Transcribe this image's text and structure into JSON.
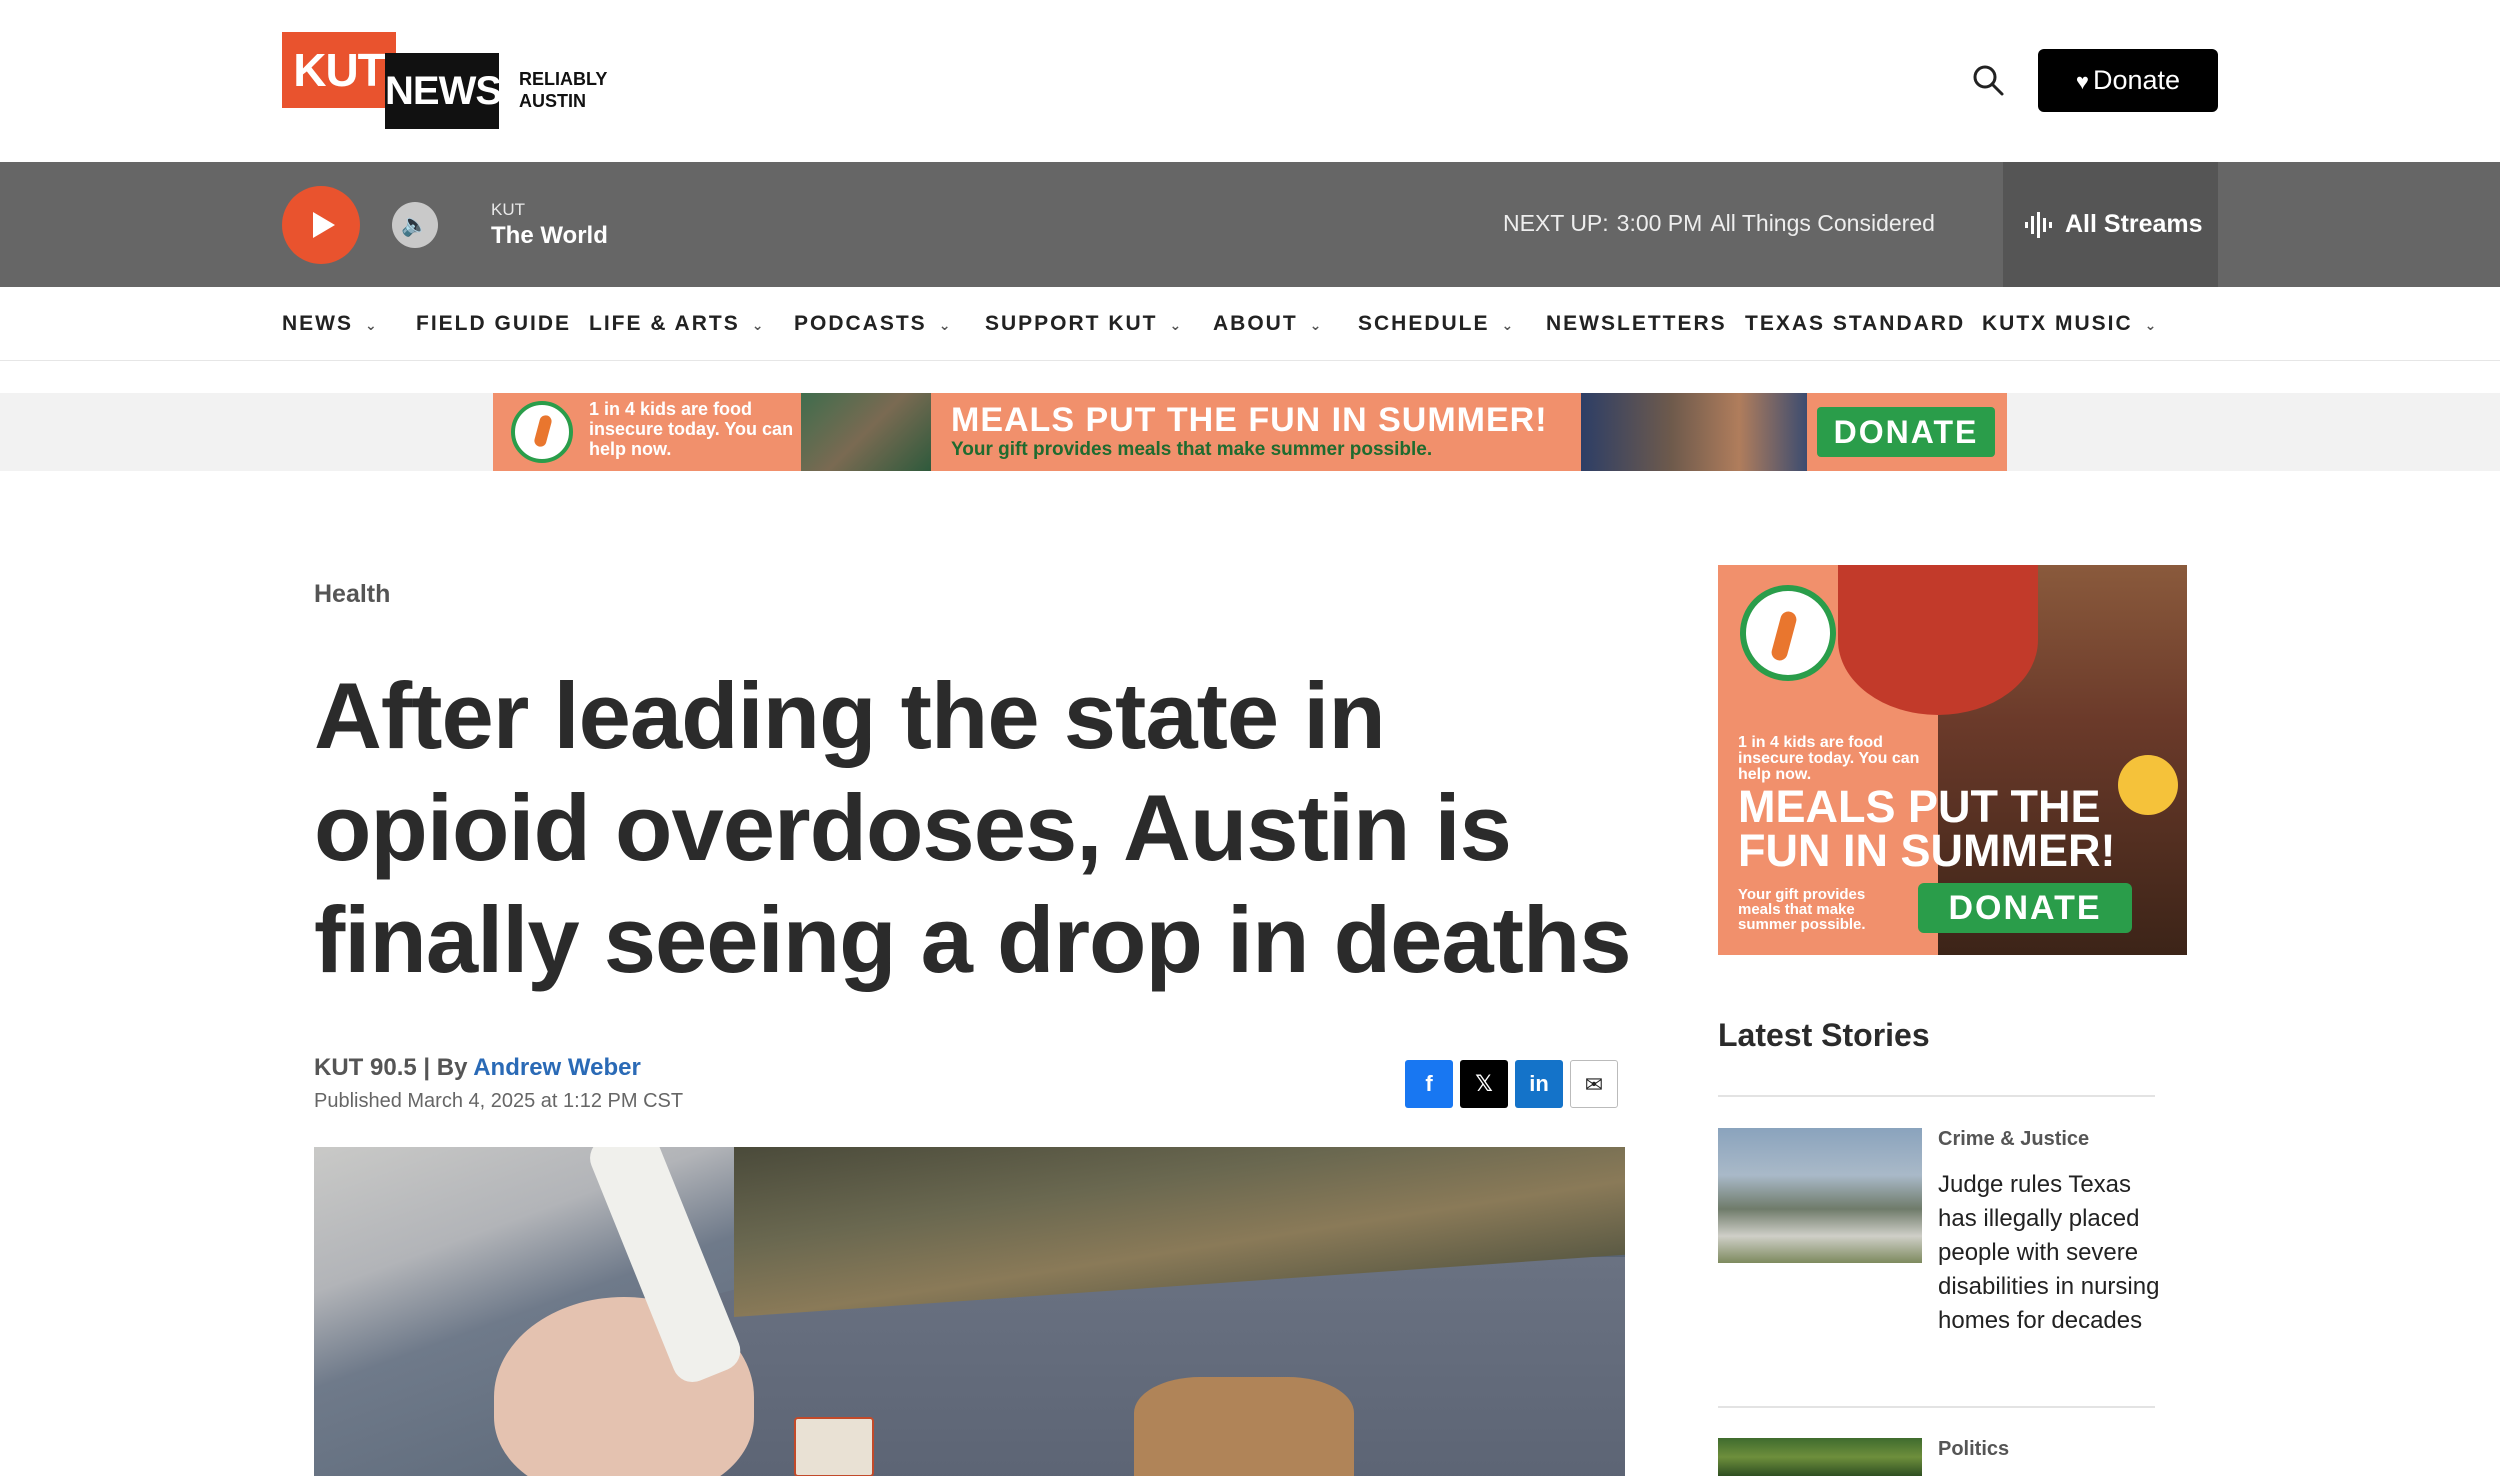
{
  "header": {
    "logo_kut": "KUT",
    "logo_news": "NEWS",
    "logo_tagline": "RELIABLY AUSTIN",
    "donate_label": "Donate"
  },
  "player": {
    "station": "KUT",
    "show": "The World",
    "next_up_label": "NEXT UP:",
    "next_up_time": "3:00 PM",
    "next_up_show": "All Things Considered",
    "streams_label": "All Streams"
  },
  "nav": {
    "items": [
      {
        "label": "NEWS",
        "dropdown": true
      },
      {
        "label": "FIELD GUIDE",
        "dropdown": false
      },
      {
        "label": "LIFE & ARTS",
        "dropdown": true
      },
      {
        "label": "PODCASTS",
        "dropdown": true
      },
      {
        "label": "SUPPORT KUT",
        "dropdown": true
      },
      {
        "label": "ABOUT",
        "dropdown": true
      },
      {
        "label": "SCHEDULE",
        "dropdown": true
      },
      {
        "label": "NEWSLETTERS",
        "dropdown": false
      },
      {
        "label": "TEXAS STANDARD",
        "dropdown": false
      },
      {
        "label": "KUTX MUSIC",
        "dropdown": true
      }
    ]
  },
  "banner_ad": {
    "small_text": "1 in 4 kids are food insecure today. You can help now.",
    "headline": "MEALS PUT THE FUN IN SUMMER!",
    "subline": "Your gift provides meals that make summer possible.",
    "cta": "DONATE"
  },
  "article": {
    "category": "Health",
    "headline": "After leading the state in opioid overdoses, Austin is finally seeing a drop in deaths",
    "source": "KUT 90.5 | By ",
    "author": "Andrew Weber",
    "published": "Published March 4, 2025 at 1:12 PM CST"
  },
  "share": {
    "facebook": "f",
    "x": "𝕏",
    "linkedin": "in",
    "email": "✉"
  },
  "sidebar_ad": {
    "small_text": "1 in 4 kids are food insecure today. You can help now.",
    "headline": "MEALS PUT THE FUN IN SUMMER!",
    "subline": "Your gift provides meals that make summer possible.",
    "cta": "DONATE"
  },
  "latest": {
    "title": "Latest Stories",
    "stories": [
      {
        "category": "Crime & Justice",
        "title": "Judge rules Texas has illegally placed people with severe disabilities in nursing homes for decades"
      },
      {
        "category": "Politics",
        "title": ""
      }
    ]
  },
  "colors": {
    "brand_orange": "#e9532e",
    "player_bg": "#666666",
    "link_blue": "#2a6ab6",
    "ad_green": "#2a9d4a"
  }
}
